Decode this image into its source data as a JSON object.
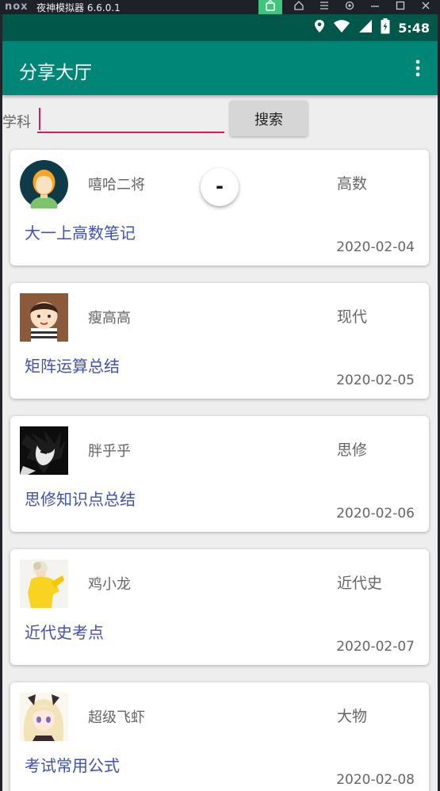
{
  "emulator": {
    "logo": "nox",
    "title": "夜神模拟器 6.6.0.1"
  },
  "status_bar": {
    "time": "5:48",
    "icons": [
      "location-icon",
      "wifi-icon",
      "signal-icon",
      "battery-charging-icon"
    ]
  },
  "toolbar": {
    "title": "分享大厅",
    "menu_icon": "overflow-menu-icon"
  },
  "search": {
    "label": "学科",
    "input_value": "",
    "button_label": "搜索"
  },
  "fab": {
    "label": "-"
  },
  "cards": [
    {
      "name": "嘻哈二将",
      "subject": "高数",
      "title": "大一上高数笔记",
      "date": "2020-02-04",
      "avatar": "cartoon-girl-avatar"
    },
    {
      "name": "瘦高高",
      "subject": "现代",
      "title": "矩阵运算总结",
      "date": "2020-02-05",
      "avatar": "cartoon-boy-avatar"
    },
    {
      "name": "胖乎乎",
      "subject": "思修",
      "title": "思修知识点总结",
      "date": "2020-02-06",
      "avatar": "dark-anime-avatar"
    },
    {
      "name": "鸡小龙",
      "subject": "近代史",
      "title": "近代史考点",
      "date": "2020-02-07",
      "avatar": "yellow-figure-avatar"
    },
    {
      "name": "超级飞虾",
      "subject": "大物",
      "title": "考试常用公式",
      "date": "2020-02-08",
      "avatar": "anime-girl-avatar"
    }
  ]
}
